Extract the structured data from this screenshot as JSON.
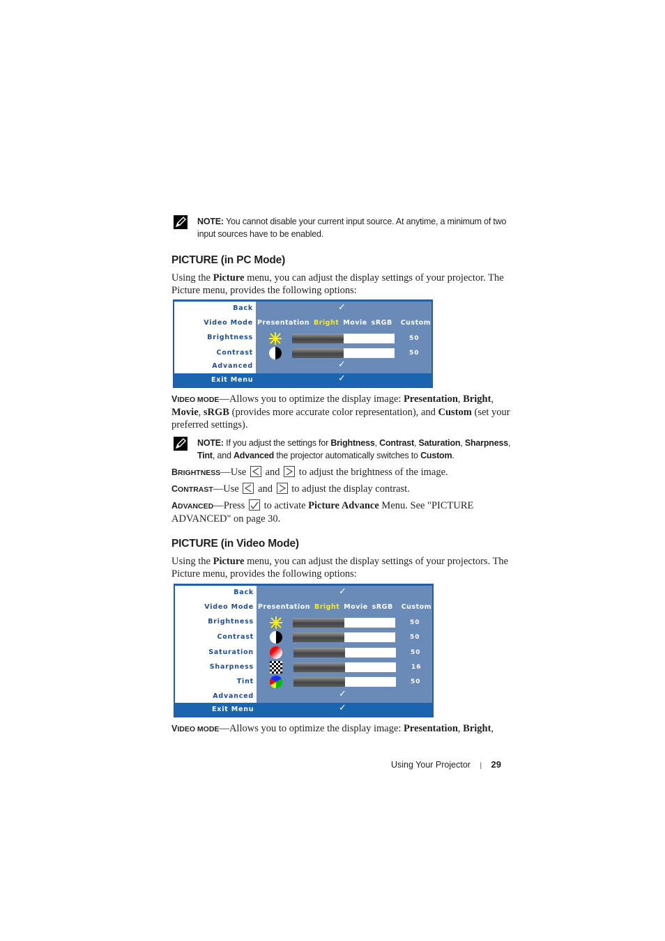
{
  "note1": {
    "label": "NOTE:",
    "text": "You cannot disable your current input source. At anytime, a minimum of two input sources have to be enabled."
  },
  "pc_section": {
    "heading": "PICTURE (in PC Mode)",
    "intro_pre": "Using the ",
    "intro_bold": "Picture",
    "intro_post": " menu, you can adjust the display settings of your projector. The Picture menu, provides the following options:",
    "menu": {
      "back": "Back",
      "video_mode": "Video Mode",
      "modes": [
        "Presentation",
        "Bright",
        "Movie",
        "sRGB",
        "Custom"
      ],
      "selected_mode": "Bright",
      "brightness": {
        "label": "Brightness",
        "value": "50",
        "level": 50
      },
      "contrast": {
        "label": "Contrast",
        "value": "50",
        "level": 50
      },
      "advanced": "Advanced",
      "exit": "Exit Menu",
      "check": "✓"
    }
  },
  "video_mode_desc": {
    "term_cap": "V",
    "term_rest": "IDEO MODE",
    "dash": "—",
    "p1": "Allows you to optimize the display image: ",
    "b1": "Presentation",
    "c1": ", ",
    "b2": "Bright",
    "c2": ", ",
    "b3": "Movie",
    "c3": ", ",
    "b4": "sRGB",
    "p2": " (provides more accurate color representation), and ",
    "b5": "Custom",
    "p3": " (set your preferred settings)."
  },
  "note2": {
    "label": "NOTE:",
    "p1": "If you adjust the settings for ",
    "b1": "Brightness",
    "c1": ", ",
    "b2": "Contrast",
    "c2": ", ",
    "b3": "Saturation",
    "c3": ", ",
    "b4": "Sharpness",
    "c4": ", ",
    "b5": "Tint",
    "c5": ", and ",
    "b6": "Advanced",
    "p2": " the projector automatically switches to ",
    "b7": "Custom",
    "p3": "."
  },
  "brightness_desc": {
    "term_cap": "B",
    "term_rest": "RIGHTNESS",
    "dash": "—",
    "use": "Use",
    "and": "and",
    "text": "to adjust the brightness of the image."
  },
  "contrast_desc": {
    "term_cap": "C",
    "term_rest": "ONTRAST",
    "dash": "—",
    "use": "Use",
    "and": "and",
    "text": "to adjust the display contrast."
  },
  "advanced_desc": {
    "term_cap": "A",
    "term_rest": "DVANCED",
    "dash": "—",
    "press": "Press",
    "p1": "to activate ",
    "b1": "Picture Advance",
    "p2": " Menu. See \"PICTURE ADVANCED\" on page 30."
  },
  "video_section": {
    "heading": "PICTURE (in Video Mode)",
    "intro_pre": "Using the ",
    "intro_bold": "Picture",
    "intro_post": " menu, you can adjust the display settings of your projectors. The Picture menu, provides the following options:",
    "menu": {
      "back": "Back",
      "video_mode": "Video Mode",
      "modes": [
        "Presentation",
        "Bright",
        "Movie",
        "sRGB",
        "Custom"
      ],
      "selected_mode": "Bright",
      "brightness": {
        "label": "Brightness",
        "value": "50",
        "level": 50
      },
      "contrast": {
        "label": "Contrast",
        "value": "50",
        "level": 50
      },
      "saturation": {
        "label": "Saturation",
        "value": "50",
        "level": 50
      },
      "sharpness": {
        "label": "Sharpness",
        "value": "16",
        "level": 50
      },
      "tint": {
        "label": "Tint",
        "value": "50",
        "level": 50
      },
      "advanced": "Advanced",
      "exit": "Exit Menu",
      "check": "✓"
    }
  },
  "video_mode_desc2": {
    "term_cap": "V",
    "term_rest": "IDEO MODE",
    "dash": "—",
    "p1": "Allows you to optimize the display image: ",
    "b1": "Presentation",
    "c1": ", ",
    "b2": "Bright",
    "c2": ","
  },
  "footer": {
    "section": "Using Your Projector",
    "separator": "|",
    "page": "29"
  },
  "colors": {
    "osd_blue": "#1b64b0",
    "osd_panel": "#6a8ab8",
    "osd_label": "#1f4e94",
    "osd_selected": "#ffee00"
  }
}
